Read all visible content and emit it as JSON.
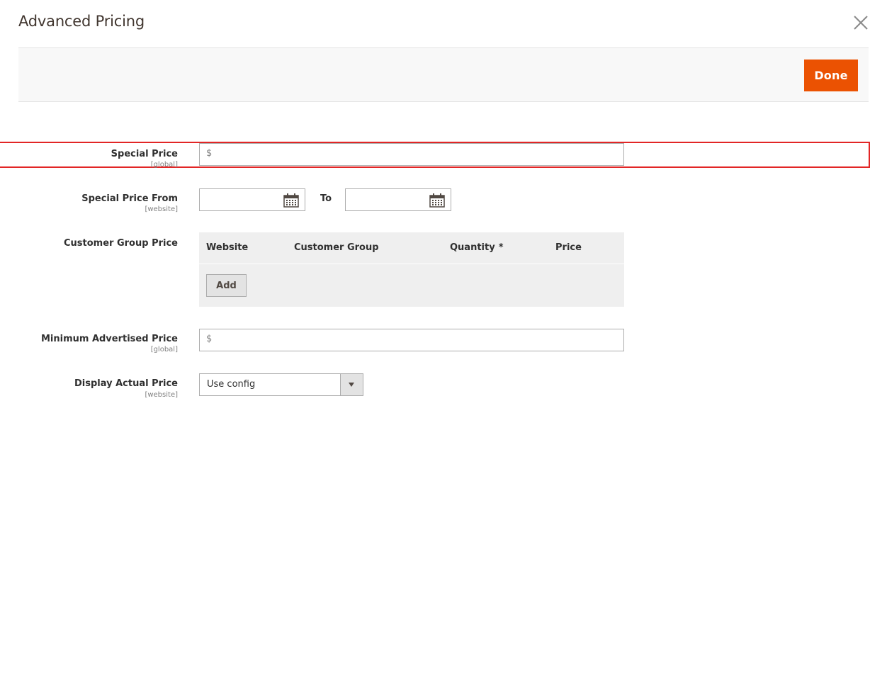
{
  "modal": {
    "title": "Advanced Pricing",
    "done_label": "Done"
  },
  "fields": {
    "special_price": {
      "label": "Special Price",
      "scope": "[global]",
      "currency": "$",
      "value": ""
    },
    "special_price_from": {
      "label": "Special Price From",
      "scope": "[website]",
      "from_value": "",
      "to_label": "To",
      "to_value": ""
    },
    "customer_group_price": {
      "label": "Customer Group Price",
      "columns": [
        "Website",
        "Customer Group",
        "Quantity",
        "Price"
      ],
      "required_mark": "*",
      "add_label": "Add"
    },
    "msrp": {
      "label": "Minimum Advertised Price",
      "scope": "[global]",
      "currency": "$",
      "value": ""
    },
    "display_actual_price": {
      "label": "Display Actual Price",
      "scope": "[website]",
      "selected": "Use config"
    }
  },
  "colors": {
    "primary_button": "#eb5202",
    "highlight": "#e22626",
    "required": "#e22626"
  },
  "icons": {
    "close": "close-icon",
    "calendar": "calendar-icon",
    "dropdown": "chevron-down-icon"
  }
}
